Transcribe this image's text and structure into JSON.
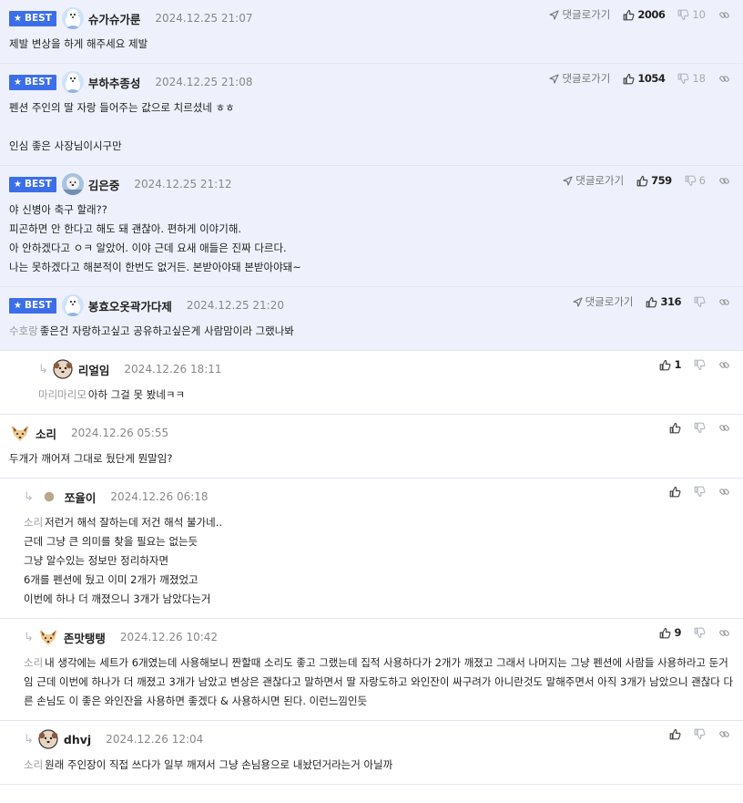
{
  "labels": {
    "best": "BEST",
    "goto": "댓글로가기"
  },
  "colors": {
    "accent": "#3b6ee8",
    "best_bg": "#eef1fb",
    "tag": "#9a9a9a"
  },
  "comments": [
    {
      "best": true,
      "indent": 0,
      "avatar": "dog-avatar-blue",
      "nick": "슈가슈가룬",
      "date": "2024.12.25 21:07",
      "up": "2006",
      "down": "10",
      "goto": true,
      "lines": [
        {
          "tag": "",
          "text": "제발 변상을 하게 해주세요 제발"
        }
      ]
    },
    {
      "best": true,
      "indent": 0,
      "avatar": "dog-avatar-blue",
      "nick": "부하추종성",
      "date": "2024.12.25 21:08",
      "up": "1054",
      "down": "18",
      "goto": true,
      "lines": [
        {
          "tag": "",
          "text": "펜션 주인의 딸 자랑 들어주는 값으로 치르셨네 ㅎㅎ"
        },
        {
          "tag": "",
          "text": ""
        },
        {
          "tag": "",
          "text": "인심 좋은 사장님이시구만"
        }
      ]
    },
    {
      "best": true,
      "indent": 0,
      "avatar": "dog-avatar-photo",
      "nick": "김은중",
      "date": "2024.12.25 21:12",
      "up": "759",
      "down": "6",
      "goto": true,
      "lines": [
        {
          "tag": "",
          "text": "야 신병아 축구 할래??"
        },
        {
          "tag": "",
          "text": "피곤하면 안 한다고 해도 돼 괜찮아. 편하게 이야기해."
        },
        {
          "tag": "",
          "text": "아 안하겠다고 ㅇㅋ 알았어. 이야 근데 요새 애들은 진짜 다르다."
        },
        {
          "tag": "",
          "text": "나는 못하겠다고 해본적이 한번도 없거든. 본받아야돼 본받아야돼~"
        }
      ]
    },
    {
      "best": true,
      "indent": 0,
      "avatar": "dog-avatar-blue",
      "nick": "봉효오옷곽가다제",
      "date": "2024.12.25 21:20",
      "up": "316",
      "down": "",
      "goto": true,
      "lines": [
        {
          "tag": "수호랑",
          "text": "좋은건 자랑하고싶고 공유하고싶은게 사람맘이라 그랬나봐"
        }
      ]
    },
    {
      "best": false,
      "indent": 2,
      "avatar": "dog-avatar-brown",
      "nick": "리얼임",
      "date": "2024.12.26 18:11",
      "up": "1",
      "down": "",
      "goto": false,
      "lines": [
        {
          "tag": "마리마리모",
          "text": "아하 그걸 못 봤네ㅋㅋ"
        }
      ]
    },
    {
      "best": false,
      "indent": 0,
      "avatar": "fox-avatar",
      "nick": "소리",
      "date": "2024.12.26 05:55",
      "up": "",
      "down": "",
      "goto": false,
      "lines": [
        {
          "tag": "",
          "text": "두개가 깨어져 그대로 뒀단게 뭔말임?"
        }
      ]
    },
    {
      "best": false,
      "indent": 1,
      "avatar": "circle-avatar",
      "nick": "쪼율이",
      "date": "2024.12.26 06:18",
      "up": "",
      "down": "",
      "goto": false,
      "lines": [
        {
          "tag": "소리",
          "text": "저런거 해석 잘하는데 저건 해석 불가네.."
        },
        {
          "tag": "",
          "text": "근데 그냥 큰 의미를 찾을 필요는 없는듯"
        },
        {
          "tag": "",
          "text": "그냥 알수있는 정보만 정리하자면"
        },
        {
          "tag": "",
          "text": "6개를 펜션에 뒀고 이미 2개가 깨졌었고"
        },
        {
          "tag": "",
          "text": "이번에 하나 더 깨졌으니 3개가 남았다는거"
        }
      ]
    },
    {
      "best": false,
      "indent": 1,
      "avatar": "fox-avatar",
      "nick": "존맛탱탱",
      "date": "2024.12.26 10:42",
      "up": "9",
      "down": "",
      "goto": false,
      "lines": [
        {
          "tag": "소리",
          "text": "내 생각에는 세트가 6개였는데 사용해보니 짠할때 소리도 좋고 그랬는데 집적 사용하다가 2개가 깨졌고 그래서 나머지는 그냥 펜션에 사람들 사용하라고 둔거임 근데 이번에 하나가 더 깨졌고 3개가 남았고 변상은 괜찮다고 말하면서 딸 자랑도하고 와인잔이 싸구려가 아니란것도 말해주면서 아직 3개가 남았으니 괜찮다 다른 손님도 이 좋은 와인잔을 사용하면 좋겠다 & 사용하시면 된다. 이런느낌인듯"
        }
      ]
    },
    {
      "best": false,
      "indent": 1,
      "avatar": "dog-avatar-brown",
      "nick": "dhvj",
      "date": "2024.12.26 12:04",
      "up": "",
      "down": "",
      "goto": false,
      "lines": [
        {
          "tag": "소리",
          "text": "원래 주인장이 직접 쓰다가 일부 깨져서 그냥 손님용으로 내놨던거라는거 아닐까"
        }
      ]
    }
  ]
}
